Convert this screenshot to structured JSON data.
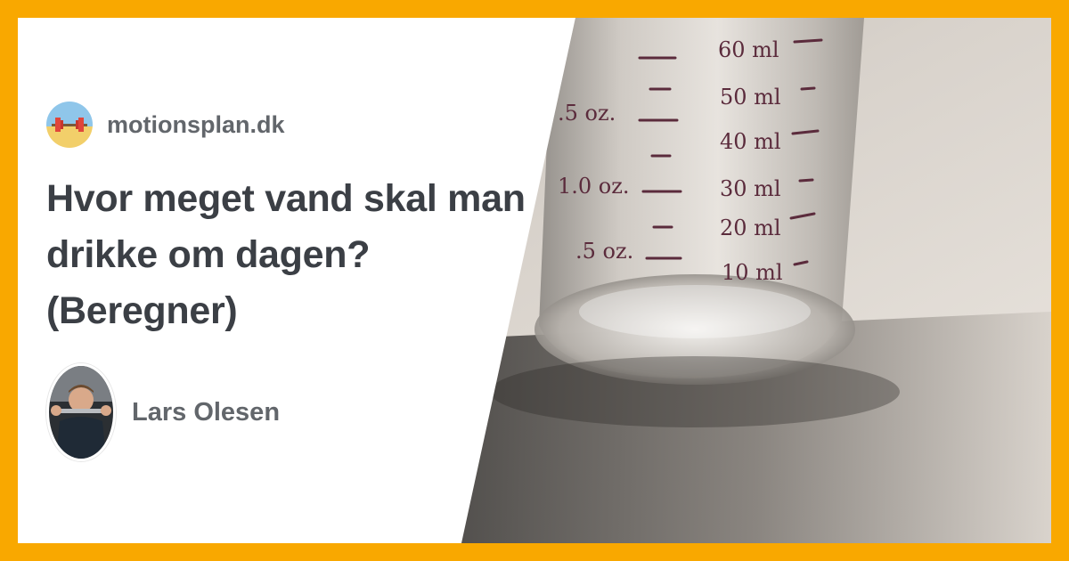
{
  "site": {
    "name": "motionsplan.dk",
    "logo_icon": "barbell-icon"
  },
  "article": {
    "title": "Hvor meget vand skal man drikke om dagen? (Beregner)"
  },
  "author": {
    "name": "Lars Olesen"
  },
  "image": {
    "subject": "measuring-glass",
    "left_scale": [
      ".5 oz.",
      "1.0 oz.",
      ".5 oz."
    ],
    "right_scale": [
      "60 ml",
      "50 ml",
      "40 ml",
      "30 ml",
      "20 ml",
      "10 ml"
    ]
  },
  "colors": {
    "border": "#f9a800",
    "title": "#3b3f45",
    "muted": "#62666b"
  }
}
